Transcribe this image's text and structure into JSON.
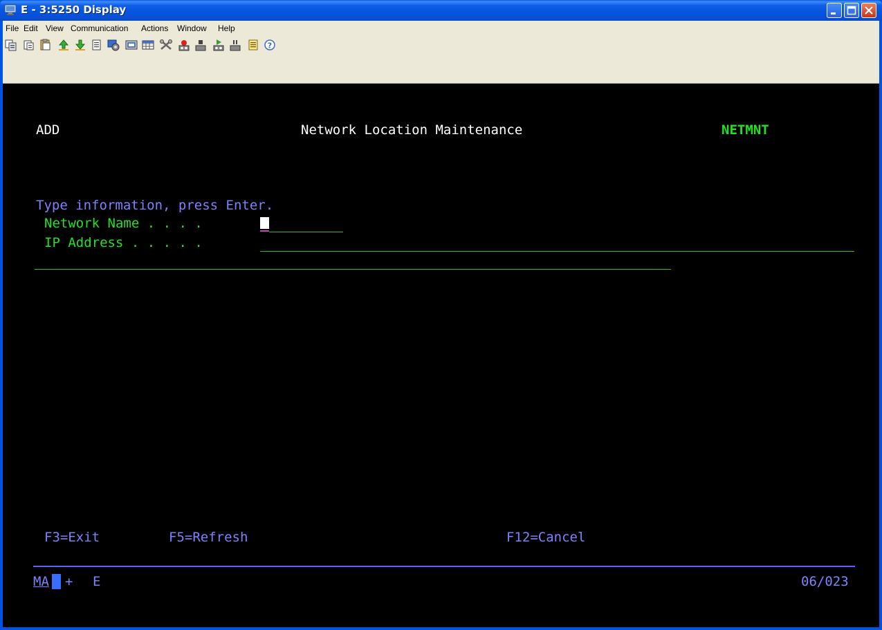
{
  "window": {
    "title": "E - 3:5250 Display"
  },
  "menubar": {
    "items": [
      "File",
      "Edit",
      "View",
      "Communication",
      "Actions",
      "Window",
      "Help"
    ]
  },
  "toolbar": {
    "icons": [
      "copy-screen-icon",
      "paste-icon",
      "paste-special-icon",
      "send-file-icon",
      "receive-file-icon",
      "print-icon",
      "macro-icon",
      "keypad-icon",
      "grid-icon",
      "customize-icon",
      "record-macro-icon",
      "stop-macro-icon",
      "play-macro-icon",
      "pause-macro-icon",
      "notes-icon",
      "help-icon"
    ]
  },
  "screen": {
    "mode": "ADD",
    "title": "Network Location Maintenance",
    "program": "NETMNT",
    "instruction": "Type information, press Enter.",
    "network_name_label": "Network Name . . . .",
    "network_name_value": "",
    "ip_address_label": "IP Address . . . . .",
    "ip_address_value": "",
    "fkeys": {
      "exit": "F3=Exit",
      "refresh": "F5=Refresh",
      "cancel": "F12=Cancel"
    },
    "oia": {
      "indicator": "MA",
      "plus": "+",
      "session": "E",
      "cursor_position": "06/023"
    }
  },
  "colors": {
    "screen_bg": "#000000",
    "field_green": "#22e022",
    "prompt_blue": "#8080ff",
    "text_white": "#ffffff",
    "titlebar_blue": "#0054e3"
  }
}
